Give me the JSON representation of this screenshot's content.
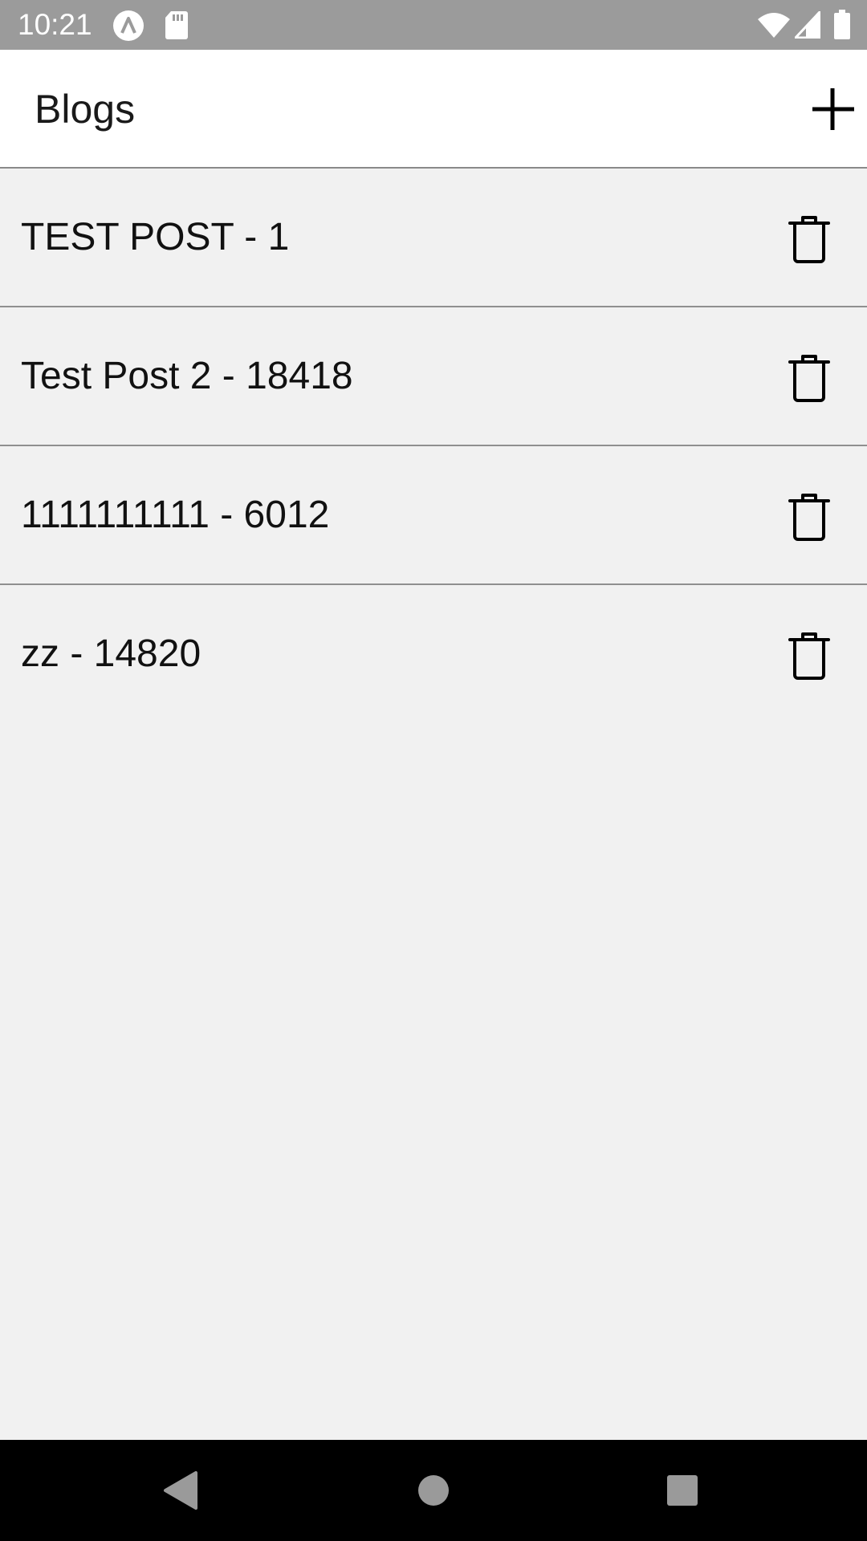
{
  "status_bar": {
    "time": "10:21",
    "icons": [
      "app-notification-icon",
      "sd-card-icon",
      "wifi-icon",
      "signal-icon",
      "battery-icon"
    ]
  },
  "header": {
    "title": "Blogs",
    "add_icon": "plus-icon"
  },
  "posts": [
    {
      "label": "TEST POST - 1",
      "action_icon": "trash-icon"
    },
    {
      "label": "Test Post 2 - 18418",
      "action_icon": "trash-icon"
    },
    {
      "label": "1111111111 - 6012",
      "action_icon": "trash-icon"
    },
    {
      "label": "zz - 14820",
      "action_icon": "trash-icon"
    }
  ],
  "nav_bar": {
    "buttons": [
      "back-icon",
      "home-icon",
      "recents-icon"
    ]
  },
  "colors": {
    "status_bar": "#9b9b9b",
    "header_bg": "#ffffff",
    "list_bg": "#f1f1f1",
    "divider": "#8f8f8f",
    "nav_bar": "#000000"
  }
}
